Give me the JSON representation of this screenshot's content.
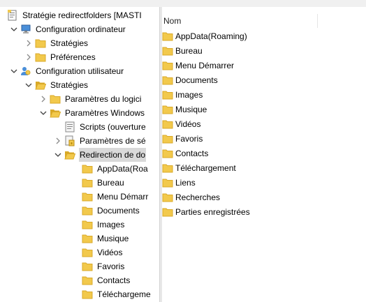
{
  "tree": {
    "root": "Stratégie redirectfolders [MASTI",
    "computer_config": "Configuration ordinateur",
    "computer_strategies": "Stratégies",
    "computer_preferences": "Préférences",
    "user_config": "Configuration utilisateur",
    "user_strategies": "Stratégies",
    "software_settings": "Paramètres du logici",
    "windows_settings": "Paramètres Windows",
    "scripts": "Scripts (ouverture",
    "security_settings": "Paramètres de sé",
    "folder_redirection": "Redirection de do",
    "folders": [
      "AppData(Roa",
      "Bureau",
      "Menu Démarr",
      "Documents",
      "Images",
      "Musique",
      "Vidéos",
      "Favoris",
      "Contacts",
      "Téléchargeme"
    ]
  },
  "list": {
    "column_name": "Nom",
    "items": [
      "AppData(Roaming)",
      "Bureau",
      "Menu Démarrer",
      "Documents",
      "Images",
      "Musique",
      "Vidéos",
      "Favoris",
      "Contacts",
      "Téléchargement",
      "Liens",
      "Recherches",
      "Parties enregistrées"
    ]
  },
  "colors": {
    "folder": "#f2c94c",
    "folder_dark": "#d9a928",
    "selection": "#d9d9d9"
  }
}
